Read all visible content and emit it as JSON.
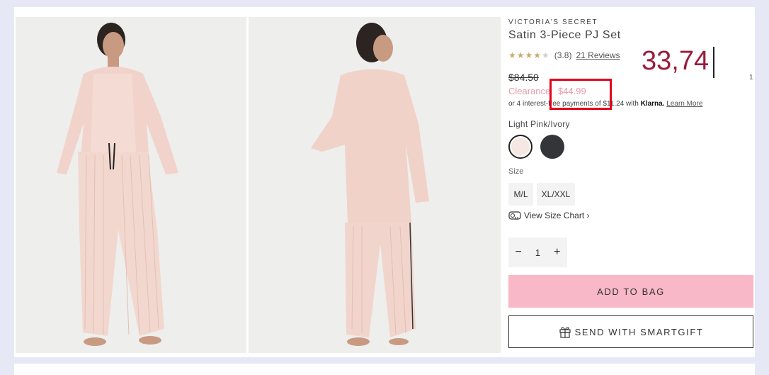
{
  "product": {
    "brand": "VICTORIA'S SECRET",
    "title": "Satin 3-Piece PJ Set",
    "stars": "★★★★",
    "stars_empty": "★",
    "rating": "(3.8)",
    "reviews": "21 Reviews",
    "old_price": "$84.50",
    "sale_label": "Clearance",
    "sale_price": "$44.99",
    "klarna_text_1": "or 4 interest-free payments of $11.24 with",
    "klarna_logo": "Klarna.",
    "klarna_learn": "Learn More",
    "color_label": "Light Pink/Ivory",
    "size_label": "Size",
    "sizes": [
      "M/L",
      "XL/XXL"
    ],
    "size_chart": "View Size Chart ›",
    "qty_minus": "−",
    "qty_value": "1",
    "qty_plus": "+",
    "add_to_bag": "ADD TO BAG",
    "smartgift": "SEND WITH SMARTGIFT"
  },
  "overlay": {
    "number": "33,74",
    "side_digit": "1"
  },
  "colors": {
    "accent_pink": "#f9b8c7",
    "sale_text": "#e89aa9",
    "highlight_red": "#e4001b",
    "overlay_number": "#9b1b3a"
  }
}
